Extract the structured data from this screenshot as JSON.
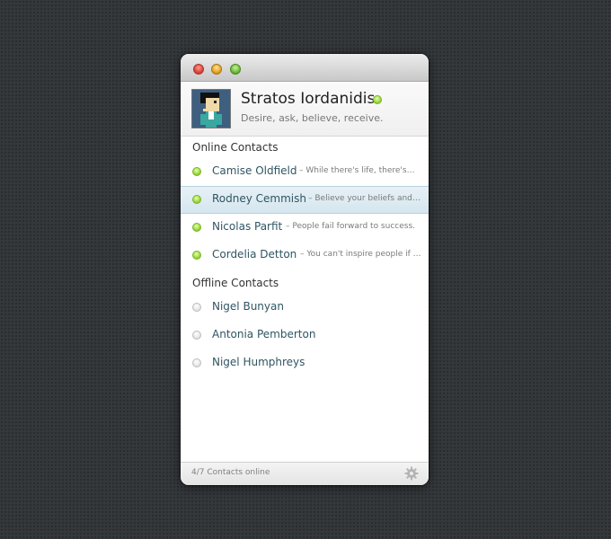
{
  "profile": {
    "name": "Stratos Iordanidis",
    "tagline": "Desire, ask, believe, receive.",
    "status": "online"
  },
  "sections": {
    "online_title": "Online Contacts",
    "offline_title": "Offline Contacts"
  },
  "online_contacts": [
    {
      "name": "Camise Oldfield",
      "status_message": "– While there's life, there's hope."
    },
    {
      "name": "Rodney Cemmish",
      "status_message": "– Believe your beliefs and doubt your doubts.",
      "selected": true
    },
    {
      "name": "Nicolas Parfit",
      "status_message": "– People fail forward to success."
    },
    {
      "name": "Cordelia Detton",
      "status_message": "– You can't inspire people if you aren't inspired."
    }
  ],
  "offline_contacts": [
    {
      "name": "Nigel Bunyan"
    },
    {
      "name": "Antonia Pemberton"
    },
    {
      "name": "Nigel Humphreys"
    }
  ],
  "footer": {
    "summary": "4/7 Contacts online"
  },
  "icons": {
    "close": "close-traffic-light-icon",
    "minimize": "minimize-traffic-light-icon",
    "zoom": "zoom-traffic-light-icon",
    "settings": "gear-icon",
    "presence_online": "green-dot-icon",
    "presence_offline": "gray-dot-icon"
  },
  "colors": {
    "online": "#9fdb3e",
    "offline": "#e6e6e6",
    "selected_row": "#d9e8f0",
    "contact_name": "#2f5562"
  }
}
